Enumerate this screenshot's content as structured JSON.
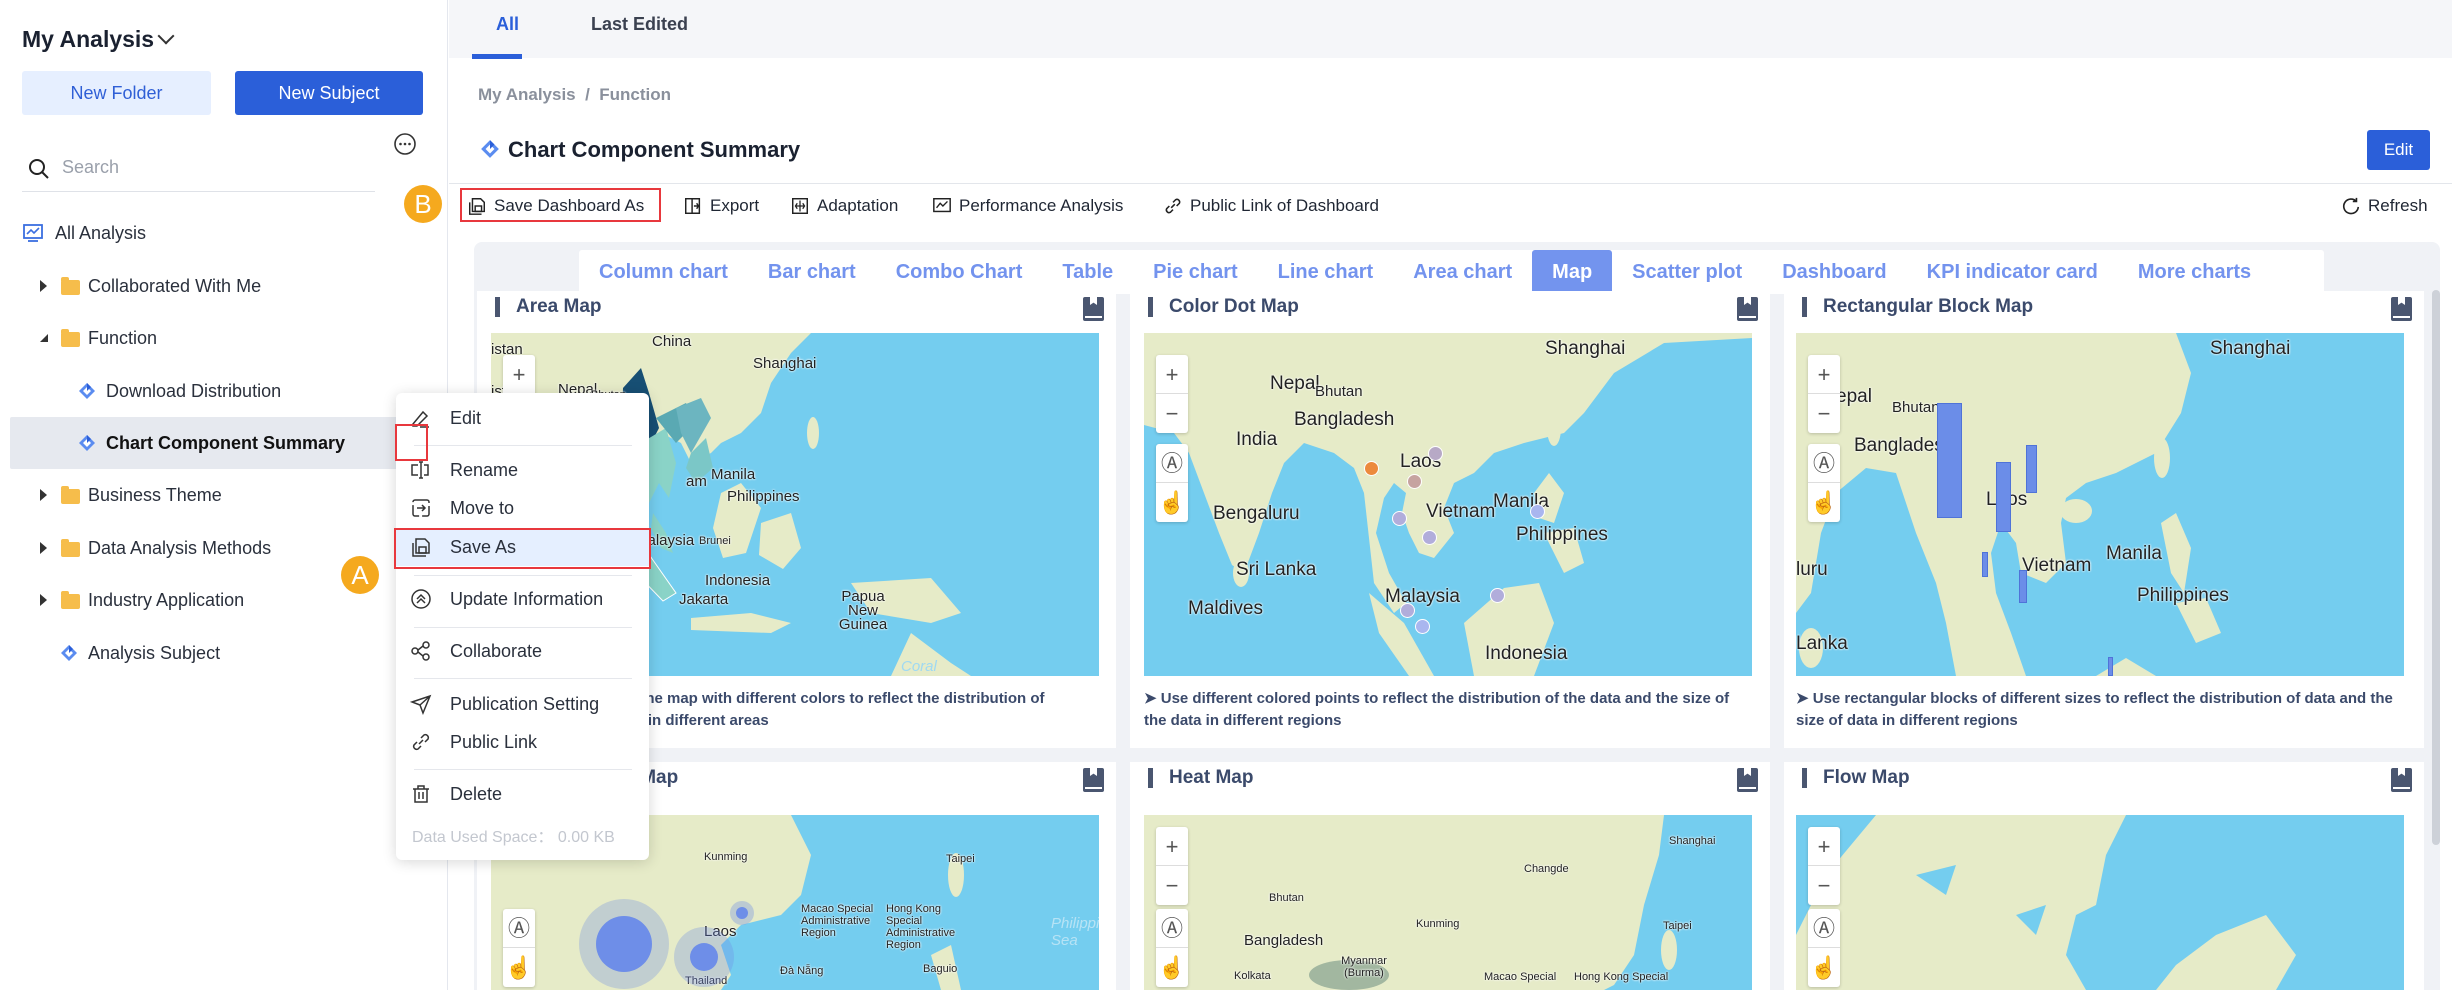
{
  "sidebar": {
    "title": "My Analysis",
    "new_folder": "New Folder",
    "new_subject": "New Subject",
    "search_placeholder": "Search",
    "tree": {
      "all_analysis": "All Analysis",
      "collaborated": "Collaborated With Me",
      "function": "Function",
      "download_distribution": "Download Distribution",
      "chart_component_summary": "Chart Component Summary",
      "business_theme": "Business Theme",
      "data_analysis_methods": "Data Analysis Methods",
      "industry_application": "Industry Application",
      "analysis_subject": "Analysis Subject"
    }
  },
  "context_menu": {
    "edit": "Edit",
    "rename": "Rename",
    "move_to": "Move to",
    "save_as": "Save As",
    "update_information": "Update Information",
    "collaborate": "Collaborate",
    "publication_setting": "Publication Setting",
    "public_link": "Public Link",
    "delete": "Delete",
    "data_used_space": "Data Used Space：  0.00 KB"
  },
  "badges": {
    "a": "A",
    "b": "B"
  },
  "top_tabs": {
    "all": "All",
    "last_edited": "Last Edited"
  },
  "breadcrumb": {
    "root": "My Analysis",
    "separator": "/",
    "current": "Function"
  },
  "page_title": "Chart Component Summary",
  "edit_button": "Edit",
  "toolbar": {
    "save_dashboard_as": "Save Dashboard As",
    "export": "Export",
    "adaptation": "Adaptation",
    "performance_analysis": "Performance Analysis",
    "public_link": "Public Link of Dashboard",
    "refresh": "Refresh"
  },
  "chart_tabs": [
    "Column chart",
    "Bar chart",
    "Combo Chart",
    "Table",
    "Pie chart",
    "Line chart",
    "Area chart",
    "Map",
    "Scatter plot",
    "Dashboard",
    "KPI indicator card",
    "More charts"
  ],
  "active_chart_tab": "Map",
  "colors": {
    "primary": "#2b5fd9",
    "accent_tab": "#7394ee",
    "badge": "#f5a91e",
    "highlight_box": "#e8383d",
    "sea": "#74cdef",
    "land": "#e6ebc8"
  },
  "cards": {
    "area_map": {
      "title": "Area Map",
      "desc_line1": "of the map with different colors to reflect the distribution of",
      "desc_line2": "ata in different areas",
      "labels": {
        "china": "China",
        "istan": "istan",
        "ista": "ista",
        "shanghai": "Shanghai",
        "nepal": "Nepal",
        "bhutan": "Bhutan",
        "vietnam_partial": "am",
        "manila": "Manila",
        "philippines": "Philippines",
        "malaysia": "Malaysia",
        "brunei": "Brunei",
        "indonesia": "Indonesia",
        "jakarta": "Jakarta",
        "png": "Papua New Guinea",
        "coral": "Coral"
      }
    },
    "color_dot_map": {
      "title": "Color Dot Map",
      "description": "➤ Use different colored points to reflect the distribution of the data and the size of the data in different regions",
      "labels": {
        "shanghai": "Shanghai",
        "nepal": "Nepal",
        "bhutan": "Bhutan",
        "bangladesh": "Bangladesh",
        "india": "India",
        "laos": "Laos",
        "vietnam": "Vietnam",
        "manila": "Manila",
        "philippines": "Philippines",
        "bengaluru": "Bengaluru",
        "sri_lanka": "Sri Lanka",
        "maldives": "Maldives",
        "malaysia": "Malaysia",
        "indonesia": "Indonesia"
      }
    },
    "rectangular_block_map": {
      "title": "Rectangular Block Map",
      "description": "➤ Use rectangular blocks of different sizes to reflect the distribution of data and the size of data in different regions",
      "labels": {
        "shanghai": "Shanghai",
        "nepal": "epal",
        "bhutan": "Bhutan",
        "bangladesh": "Bangladesl",
        "laos": "Laos",
        "vietnam": "Vietnam",
        "manila": "Manila",
        "philippines": "Philippines",
        "sri_lanka": "Lanka",
        "bengaluru": "luru"
      }
    },
    "bubble_map": {
      "title": "nt Map",
      "labels": {
        "kunming": "Kunming",
        "taipei": "Taipei",
        "laos": "Laos",
        "macao": "Macao Special Administrative Region",
        "hong_kong": "Hong Kong Special Administrative Region",
        "da_nang": "Đà Nẵng",
        "thailand": "Thailand",
        "baguio": "Baguio",
        "philippine_sea": "Philippine Sea"
      }
    },
    "heat_map": {
      "title": "Heat Map",
      "labels": {
        "shanghai": "Shanghai",
        "changde": "Changde",
        "kunming": "Kunming",
        "taipei": "Taipei",
        "bhutan": "Bhutan",
        "bangladesh": "Bangladesh",
        "kolkata": "Kolkata",
        "myanmar": "Myanmar (Burma)",
        "macao": "Macao Special",
        "hong_kong": "Hong Kong Special"
      }
    },
    "flow_map": {
      "title": "Flow Map"
    }
  },
  "map_controls": {
    "zoom_in": "+",
    "zoom_out": "−"
  }
}
